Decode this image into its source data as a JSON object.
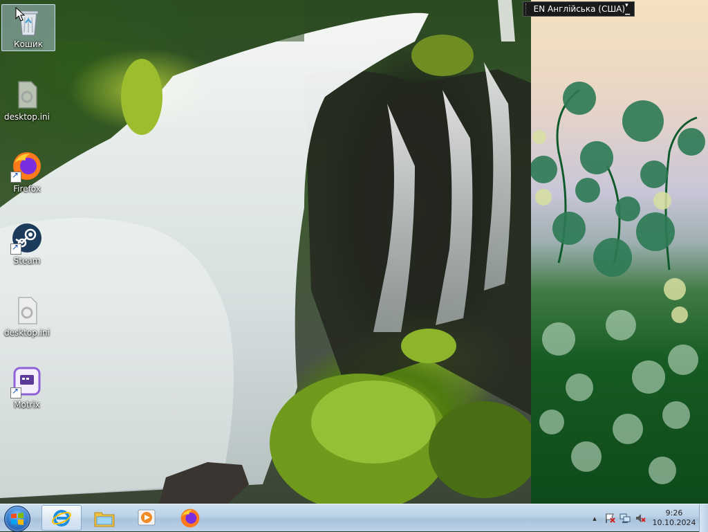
{
  "desktop": {
    "icons": [
      {
        "label": "Кошик",
        "icon": "recycle-bin-icon"
      },
      {
        "label": "desktop.ini",
        "icon": "settings-file-icon"
      },
      {
        "label": "Firefox",
        "icon": "firefox-icon"
      },
      {
        "label": "Steam",
        "icon": "steam-icon"
      },
      {
        "label": "desktop.ini",
        "icon": "settings-file-icon"
      },
      {
        "label": "Motrix",
        "icon": "motrix-icon"
      }
    ]
  },
  "language_bar": {
    "label": "EN Англійська (США)"
  },
  "taskbar": {
    "pinned": [
      {
        "icon": "internet-explorer-icon"
      },
      {
        "icon": "file-explorer-icon"
      },
      {
        "icon": "media-player-icon"
      },
      {
        "icon": "firefox-icon"
      }
    ],
    "tray": {
      "icons": [
        "show-hidden-icons-arrow",
        "action-center-flag-icon",
        "network-icon",
        "volume-muted-icon"
      ],
      "time": "9:26",
      "date": "10.10.2024"
    }
  },
  "colors": {
    "taskbar": "#b9d0e6",
    "language_bar": "#1a1a1a",
    "selection": "#bed7f0"
  }
}
